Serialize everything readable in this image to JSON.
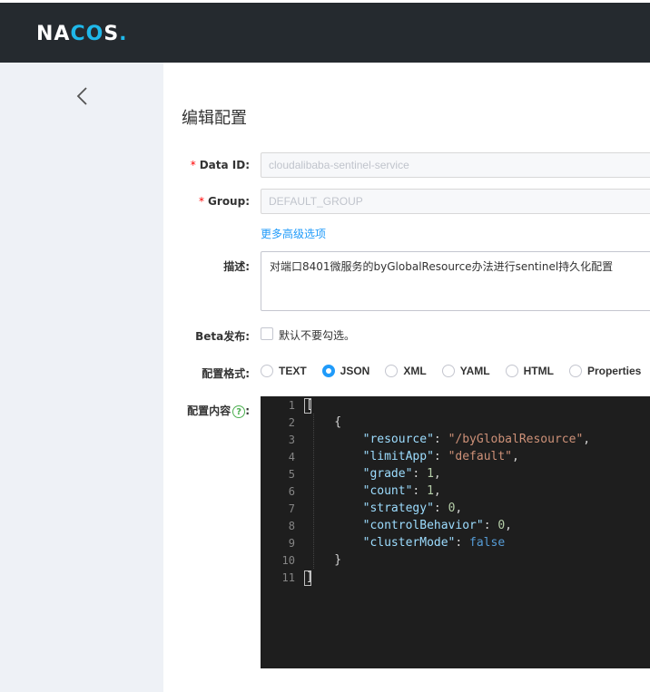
{
  "header": {
    "logo_main": "NA",
    "logo_cc": "CO",
    "logo_tail": "S",
    "logo_dot": "."
  },
  "page": {
    "title": "编辑配置"
  },
  "form": {
    "data_id": {
      "label": "Data ID:",
      "required_mark": "*",
      "value": "cloudalibaba-sentinel-service"
    },
    "group": {
      "label": "Group:",
      "required_mark": "*",
      "value": "DEFAULT_GROUP"
    },
    "advanced_link": "更多高级选项",
    "desc": {
      "label": "描述:",
      "value": "对端口8401微服务的byGlobalResource办法进行sentinel持久化配置"
    },
    "beta": {
      "label": "Beta发布:",
      "checkbox_label": "默认不要勾选。",
      "checked": false
    },
    "format": {
      "label": "配置格式:",
      "options": [
        "TEXT",
        "JSON",
        "XML",
        "YAML",
        "HTML",
        "Properties"
      ],
      "selected": "JSON"
    },
    "content": {
      "label": "配置内容",
      "help_icon": "?",
      "colon": ":"
    }
  },
  "editor": {
    "line_numbers": [
      "1",
      "2",
      "3",
      "4",
      "5",
      "6",
      "7",
      "8",
      "9",
      "10",
      "11"
    ],
    "lines": [
      "[",
      "    {",
      "        \"resource\": \"/byGlobalResource\",",
      "        \"limitApp\": \"default\",",
      "        \"grade\": 1,",
      "        \"count\": 1,",
      "        \"strategy\": 0,",
      "        \"controlBehavior\": 0,",
      "        \"clusterMode\": false",
      "    }",
      "]"
    ]
  },
  "colors": {
    "topbar": "#252a2f",
    "accent": "#209bfa",
    "sidebar": "#eef1f6",
    "editor_bg": "#1e1e1e"
  }
}
